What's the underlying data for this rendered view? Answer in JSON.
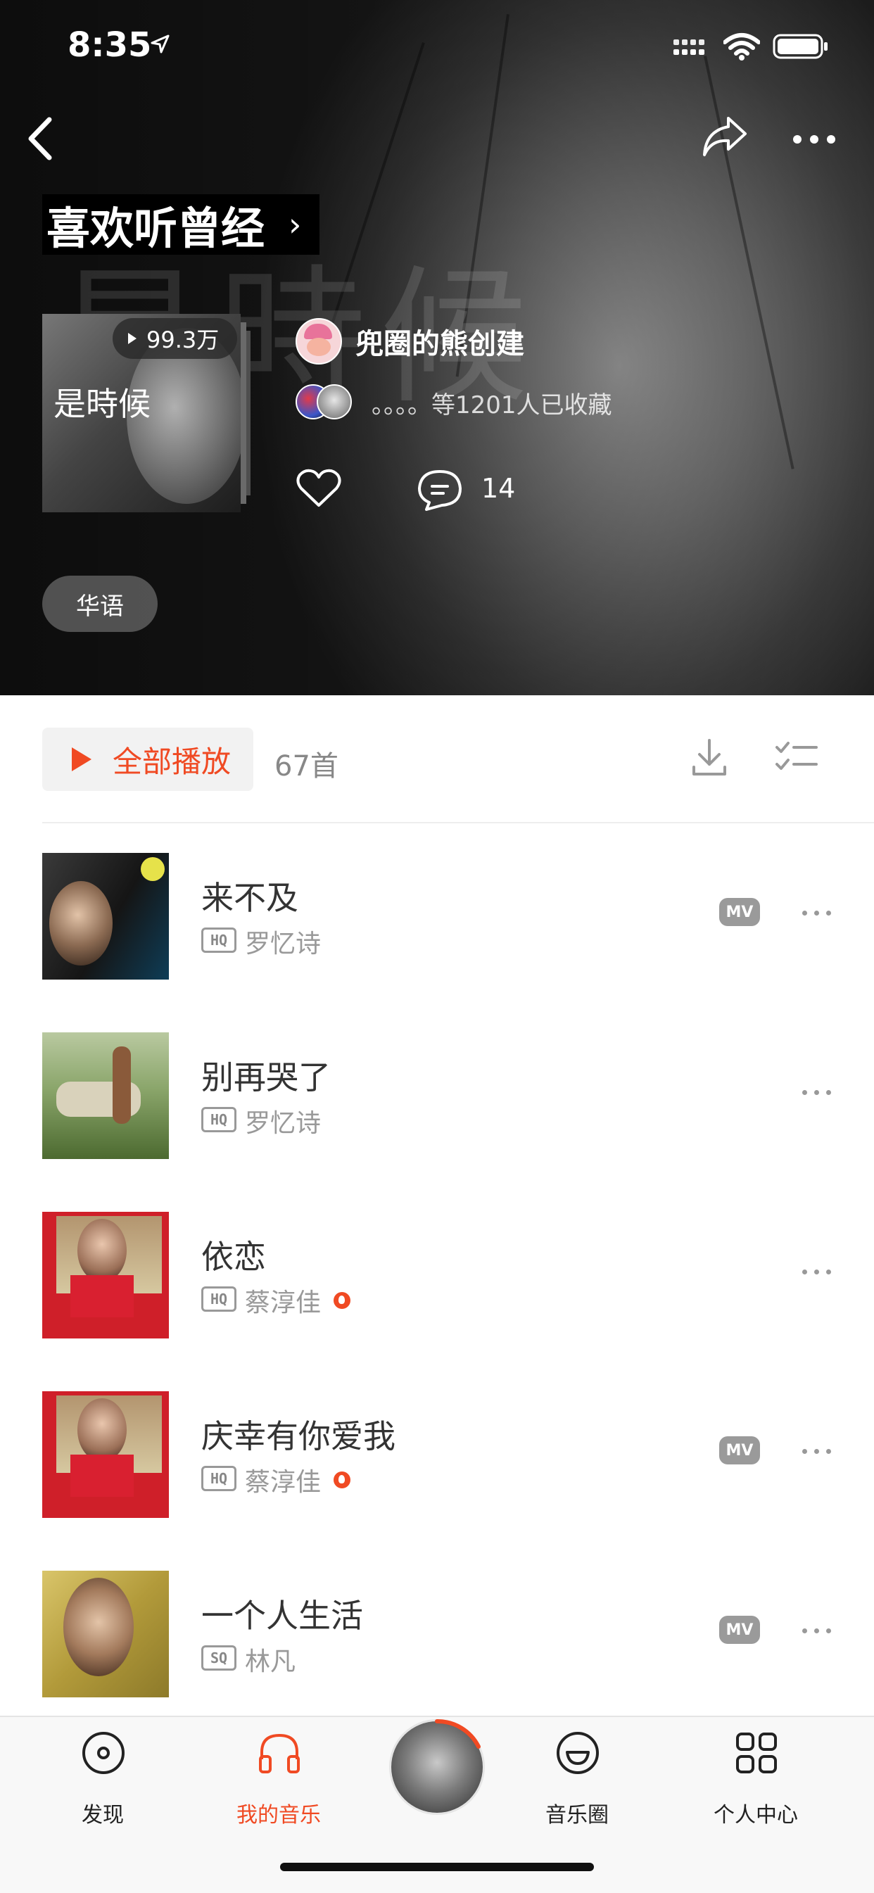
{
  "status_bar": {
    "time": "8:35"
  },
  "playlist": {
    "title": "喜欢听曾经",
    "title_chevron": "›",
    "cover_text": "是時候",
    "play_count": "99.3万",
    "creator_name": "兜圈的熊创建",
    "favorites_text": "。。。。等1201人已收藏",
    "comment_count": "14",
    "tag": "华语"
  },
  "toolbar": {
    "play_all_label": "全部播放",
    "song_count": "67首"
  },
  "songs": [
    {
      "title": "来不及",
      "quality": "HQ",
      "artist": "罗忆诗",
      "has_mv": true,
      "mv_label": "MV",
      "hot": false,
      "art_color": "#2b2b2b"
    },
    {
      "title": "别再哭了",
      "quality": "HQ",
      "artist": "罗忆诗",
      "has_mv": false,
      "hot": false,
      "art_color": "#7a9457"
    },
    {
      "title": "依恋",
      "quality": "HQ",
      "artist": "蔡淳佳",
      "has_mv": false,
      "hot": true,
      "art_color": "#d0202a"
    },
    {
      "title": "庆幸有你爱我",
      "quality": "HQ",
      "artist": "蔡淳佳",
      "has_mv": true,
      "mv_label": "MV",
      "hot": true,
      "art_color": "#d0202a"
    },
    {
      "title": "一个人生活",
      "quality": "SQ",
      "artist": "林凡",
      "has_mv": true,
      "mv_label": "MV",
      "hot": false,
      "art_color": "#c8b255"
    }
  ],
  "tabbar": {
    "items": [
      {
        "label": "发现",
        "icon": "disc-icon"
      },
      {
        "label": "我的音乐",
        "icon": "headphones-icon",
        "active": true
      },
      {
        "label": "音乐圈",
        "icon": "smile-icon"
      },
      {
        "label": "个人中心",
        "icon": "grid-icon"
      }
    ]
  },
  "colors": {
    "accent": "#f04a23",
    "mv_badge": "#9a9a9a"
  }
}
